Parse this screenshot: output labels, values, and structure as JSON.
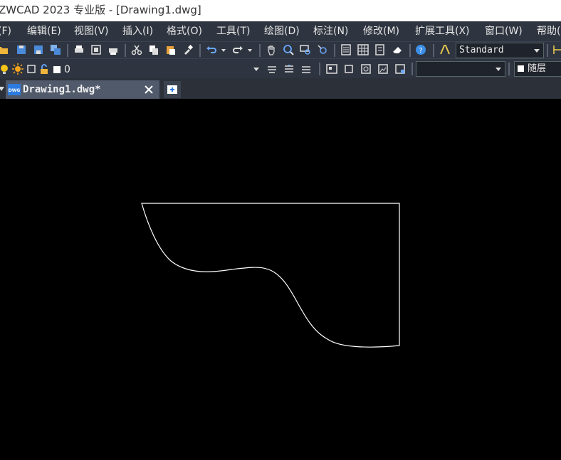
{
  "window": {
    "title": "ZWCAD 2023 专业版 - [Drawing1.dwg]"
  },
  "menu": [
    {
      "id": "file",
      "label": "(F)"
    },
    {
      "id": "edit",
      "label": "编辑(E)"
    },
    {
      "id": "view",
      "label": "视图(V)"
    },
    {
      "id": "insert",
      "label": "插入(I)"
    },
    {
      "id": "format",
      "label": "格式(O)"
    },
    {
      "id": "tools",
      "label": "工具(T)"
    },
    {
      "id": "draw",
      "label": "绘图(D)"
    },
    {
      "id": "dimension",
      "label": "标注(N)"
    },
    {
      "id": "modify",
      "label": "修改(M)"
    },
    {
      "id": "ext-tools",
      "label": "扩展工具(X)"
    },
    {
      "id": "window",
      "label": "窗口(W)"
    },
    {
      "id": "help",
      "label": "帮助("
    }
  ],
  "toolbar": {
    "text_style": "Standard",
    "layer_value": "0",
    "linetype_value": "",
    "color_value": "随层"
  },
  "tabs": [
    {
      "label": "Drawing1.dwg*",
      "doc_badge": "DWG"
    }
  ],
  "icons": {
    "open": "folder-open-icon",
    "save": "save-icon",
    "save_as": "save-as-icon",
    "save_all": "save-all-icon",
    "print": "print-icon",
    "print_preview": "print-preview-icon",
    "plot": "plot-icon",
    "cut": "scissors-icon",
    "copy": "copy-icon",
    "paste": "paste-icon",
    "match": "paintbrush-icon",
    "undo": "undo-icon",
    "redo": "redo-icon",
    "pan": "hand-icon",
    "zoom_realtime": "zoom-realtime-icon",
    "zoom_window": "zoom-window-icon",
    "zoom_prev": "zoom-previous-icon",
    "properties": "properties-icon",
    "design_center": "design-center-icon",
    "tool_palette": "tool-palette-icon",
    "eraser": "eraser-icon",
    "help": "help-icon",
    "text_style_icon": "text-style-icon",
    "layer_bulb": "lightbulb-icon",
    "layer_sun": "sun-icon",
    "layer_freeze": "freeze-icon",
    "layer_lock": "unlock-icon",
    "layer_color": "white-square-icon"
  },
  "colors": {
    "canvas_bg": "#000000",
    "chrome_bg": "#2f3540",
    "tab_active": "#515a6b",
    "drawing_stroke": "#ffffff"
  }
}
